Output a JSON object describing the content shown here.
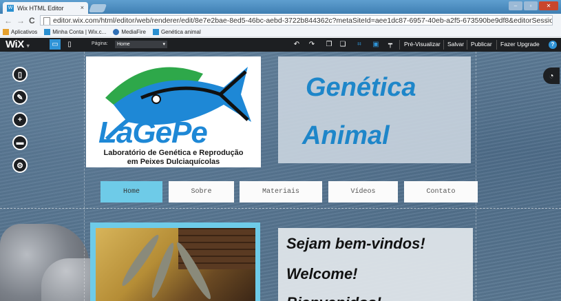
{
  "browser": {
    "tab_title": "Wix HTML Editor",
    "tab_close": "×",
    "url": "editor.wix.com/html/editor/web/renderer/edit/8e7e2bae-8ed5-46bc-aebd-3722b844362c?metaSiteId=aee1dc87-6957-40eb-a2f5-673590be9df8&editorSessionId=FFCBF",
    "back": "←",
    "forward": "→",
    "reload": "C",
    "star": "☆",
    "bookmarks": [
      {
        "label": "Aplicativos",
        "icon": "apps-grid-icon"
      },
      {
        "label": "Minha Conta | Wix.c...",
        "icon": "wix-favicon-icon"
      },
      {
        "label": "MediaFire",
        "icon": "mediafire-icon"
      },
      {
        "label": "Genética animal",
        "icon": "wix-favicon-icon"
      }
    ]
  },
  "wix_toolbar": {
    "logo": "WiX",
    "page_label": "Página:",
    "page_value": "Home",
    "actions": [
      "Pré-Visualizar",
      "Salvar",
      "Publicar",
      "Fazer Upgrade"
    ],
    "help": "?"
  },
  "site": {
    "logo_name": "LaGePe",
    "logo_subtitle_line1": "Laboratório de Genética e Reprodução",
    "logo_subtitle_line2": "em Peixes Dulciaquícolas",
    "title_line1": "Genética",
    "title_line2": "Animal",
    "menu": [
      {
        "label": "Home",
        "active": true
      },
      {
        "label": "Sobre",
        "active": false
      },
      {
        "label": "Materiais",
        "active": false
      },
      {
        "label": "Vídeos",
        "active": false
      },
      {
        "label": "Contato",
        "active": false
      }
    ],
    "welcome": [
      "Sejam bem-vindos!",
      "Welcome!",
      "Bienvenidos!"
    ]
  },
  "colors": {
    "accent": "#2f93d6",
    "menu_active": "#6ecbe8",
    "title_blue": "#1e86c9",
    "toolbar_bg": "#1d1f22"
  }
}
